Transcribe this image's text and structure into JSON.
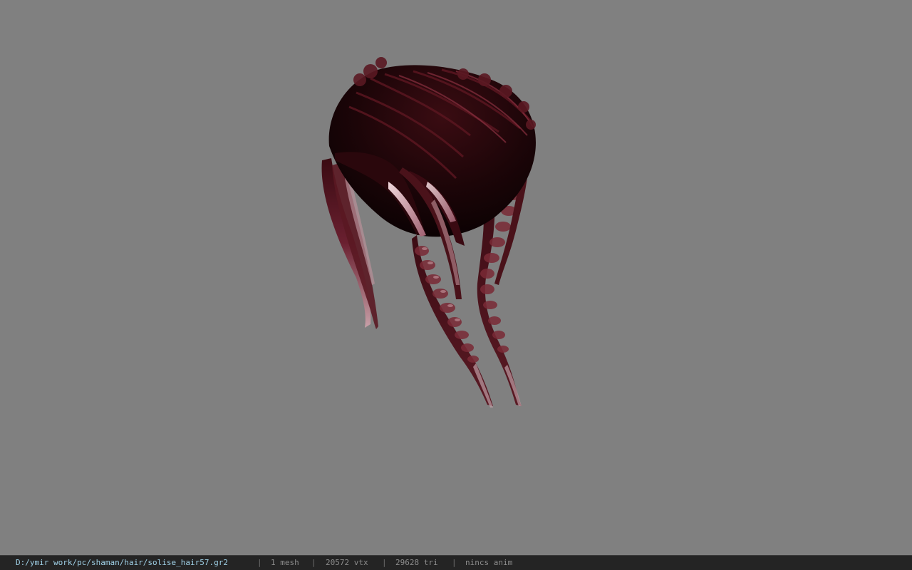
{
  "viewer": {
    "background_color": "#808080",
    "model_name": "solise_hair57",
    "model_colors": {
      "dark": "#1a0508",
      "mid": "#4a1018",
      "highlight": "#8a3a48",
      "sheen": "#e8c8cc"
    }
  },
  "statusbar": {
    "file_path": "D:/ymir work/pc/shaman/hair/solise_hair57.gr2",
    "separator": "|",
    "mesh_count": "1 mesh",
    "vertex_count": "20572 vtx",
    "triangle_count": "29628 tri",
    "anim_status": "nincs anim"
  }
}
